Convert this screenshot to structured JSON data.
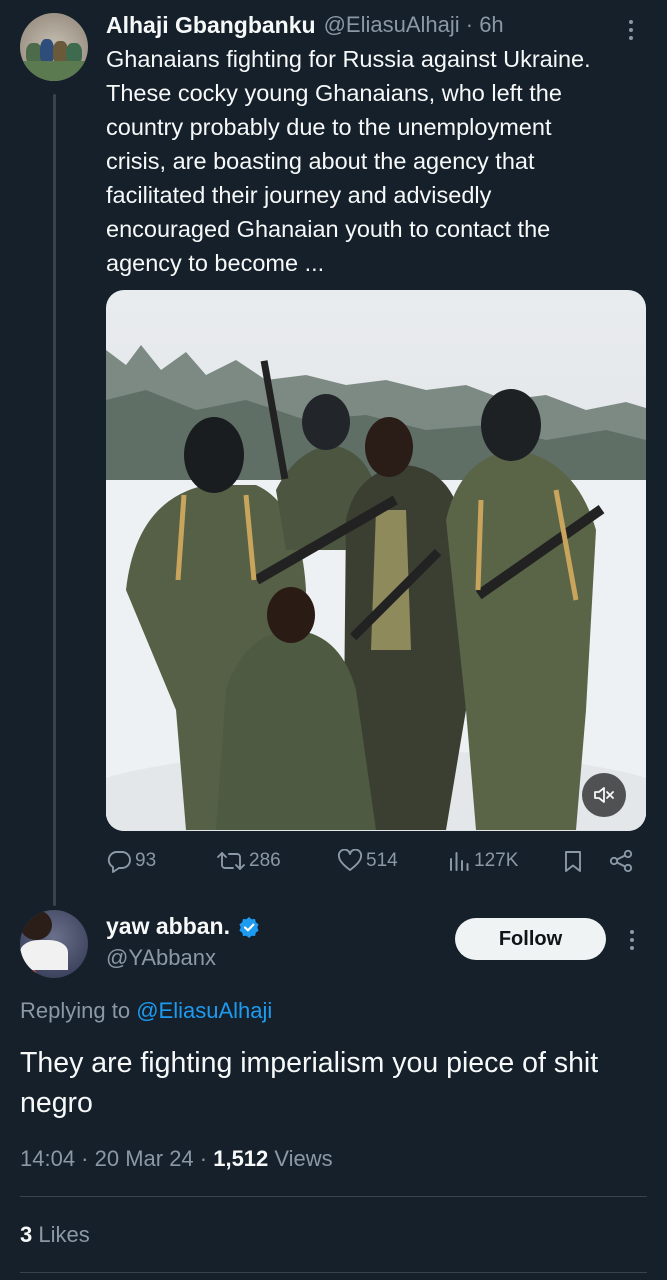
{
  "parent_tweet": {
    "display_name": "Alhaji Gbangbanku",
    "handle": "@EliasuAlhaji · 6h",
    "text_lines": [
      "Ghanaians fighting for Russia against Ukraine.",
      "These cocky young Ghanaians, who left the",
      "country probably due to the unemployment",
      "crisis, are boasting about  the agency that",
      "facilitated their journey and advisedly",
      "encouraged Ghanaian youth to contact the",
      "agency to become ..."
    ],
    "media": {
      "type": "video",
      "muted_icon": "speaker-muted-icon"
    },
    "actions": {
      "replies": "93",
      "reposts": "286",
      "likes": "514",
      "views": "127K"
    }
  },
  "reply_tweet": {
    "display_name": "yaw abban.",
    "verified_color": "#1d9bf0",
    "handle": "@YAbbanx",
    "follow_label": "Follow",
    "replying_prefix": "Replying to",
    "replying_to": "@EliasuAlhaji",
    "text": "They are fighting imperialism you piece of shit negro",
    "time": "14:04 · 20 Mar 24 · ",
    "views_count": "1,512",
    "views_label": " Views",
    "likes_count": "3",
    "likes_label": " Likes"
  },
  "colors": {
    "background": "#15202b",
    "text_primary": "#f7f9f9",
    "text_secondary": "#8b98a5",
    "accent": "#1d9bf0",
    "divider": "#38444d"
  }
}
